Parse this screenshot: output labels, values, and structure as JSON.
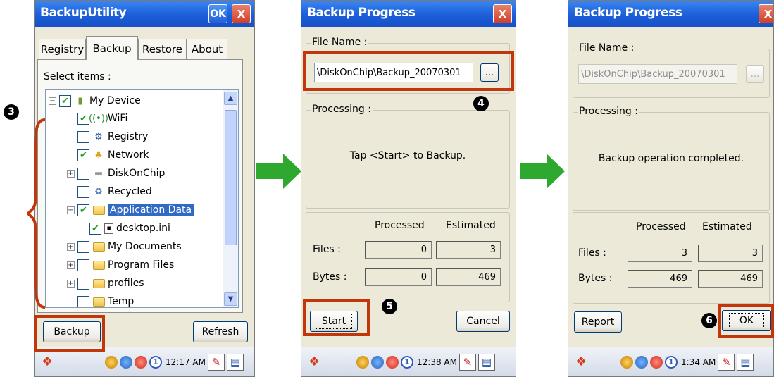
{
  "screen1": {
    "title": "BackupUtility",
    "ok_label": "OK",
    "close_label": "X",
    "tabs": [
      "Registry",
      "Backup",
      "Restore",
      "About"
    ],
    "select_label": "Select items :",
    "tree_items": [
      {
        "label": "My Device",
        "checked": true,
        "expander": "minus",
        "icon": "device-icon"
      },
      {
        "label": "WiFi",
        "checked": true,
        "icon": "wifi-icon"
      },
      {
        "label": "Registry",
        "checked": false,
        "icon": "registry-icon"
      },
      {
        "label": "Network",
        "checked": true,
        "icon": "network-icon"
      },
      {
        "label": "DiskOnChip",
        "checked": false,
        "expander": "plus",
        "icon": "disk-icon"
      },
      {
        "label": "Recycled",
        "checked": false,
        "icon": "recycle-icon"
      },
      {
        "label": "Application Data",
        "checked": true,
        "expander": "minus",
        "icon": "folder-icon",
        "selected": true
      },
      {
        "label": "desktop.ini",
        "checked": true,
        "icon": "file-icon"
      },
      {
        "label": "My Documents",
        "checked": false,
        "expander": "plus",
        "icon": "folder-icon"
      },
      {
        "label": "Program Files",
        "checked": false,
        "expander": "plus",
        "icon": "folder-icon"
      },
      {
        "label": "profiles",
        "checked": false,
        "expander": "plus",
        "icon": "folder-icon"
      },
      {
        "label": "Temp",
        "checked": false,
        "icon": "folder-icon"
      }
    ],
    "backup_button": "Backup",
    "refresh_button": "Refresh",
    "time": "12:17 AM",
    "step": "3"
  },
  "screen2": {
    "title": "Backup Progress",
    "close_label": "X",
    "file_name_label": "File Name :",
    "file_name_value": "\\DiskOnChip\\Backup_20070301",
    "browse_label": "...",
    "processing_label": "Processing :",
    "status_message": "Tap <Start> to Backup.",
    "processed_header": "Processed",
    "estimated_header": "Estimated",
    "files_label": "Files :",
    "bytes_label": "Bytes :",
    "files_processed": "0",
    "files_estimated": "3",
    "bytes_processed": "0",
    "bytes_estimated": "469",
    "start_button": "Start",
    "cancel_button": "Cancel",
    "time": "12:38 AM",
    "step_file": "4",
    "step_start": "5"
  },
  "screen3": {
    "title": "Backup Progress",
    "close_label": "X",
    "file_name_label": "File Name :",
    "file_name_value": "\\DiskOnChip\\Backup_20070301",
    "browse_label": "...",
    "processing_label": "Processing :",
    "status_message": "Backup operation completed.",
    "processed_header": "Processed",
    "estimated_header": "Estimated",
    "files_label": "Files :",
    "bytes_label": "Bytes :",
    "files_processed": "3",
    "files_estimated": "3",
    "bytes_processed": "469",
    "bytes_estimated": "469",
    "report_button": "Report",
    "ok_button": "OK",
    "time": "1:34 AM",
    "step": "6"
  },
  "colors": {
    "titlebar": "#1c5ed8",
    "highlight": "#c1360b",
    "arrow": "#2ea82e",
    "check": "#21a121",
    "selection": "#316ac5"
  }
}
